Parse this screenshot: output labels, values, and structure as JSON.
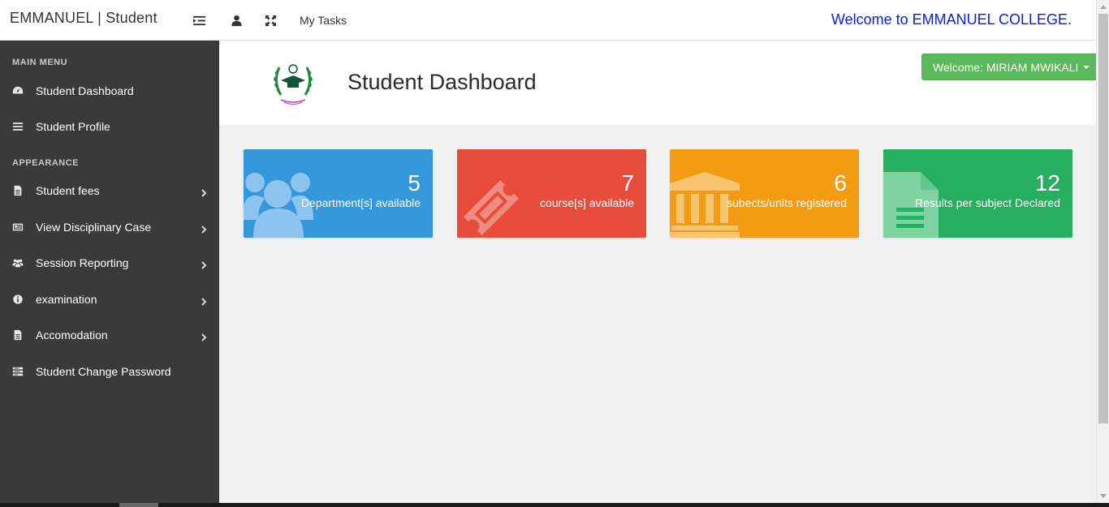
{
  "topbar": {
    "brand": "EMMANUEL | Student",
    "icons": [
      "list-indent-icon",
      "user-icon",
      "fullscreen-icon"
    ],
    "my_tasks": "My Tasks",
    "welcome_college": "Welcome to EMMANUEL COLLEGE."
  },
  "sidebar": {
    "main_menu_label": "MAIN MENU",
    "appearance_label": "APPEARANCE",
    "items": [
      {
        "label": "Student Dashboard",
        "icon": "dashboard-icon",
        "submenu": false
      },
      {
        "label": "Student Profile",
        "icon": "bars-icon",
        "submenu": false
      },
      {
        "label": "Student fees",
        "icon": "file-icon",
        "submenu": true
      },
      {
        "label": "View Disciplinary Case",
        "icon": "newspaper-icon",
        "submenu": true
      },
      {
        "label": "Session Reporting",
        "icon": "users-icon",
        "submenu": true
      },
      {
        "label": "examination",
        "icon": "info-icon",
        "submenu": true
      },
      {
        "label": "Accomodation",
        "icon": "file-icon",
        "submenu": true
      },
      {
        "label": "Student Change Password",
        "icon": "tasks-icon",
        "submenu": false
      }
    ]
  },
  "header": {
    "title": "Student Dashboard",
    "welcome_button": "Welcome: MIRIAM MWIKALI",
    "logo_icon": "emmanuel-college-logo"
  },
  "cards": [
    {
      "count": "5",
      "label": "Department[s] available",
      "color": "#3498db",
      "icon": "users-icon"
    },
    {
      "count": "7",
      "label": "course[s] available",
      "color": "#e74c3c",
      "icon": "ticket-icon"
    },
    {
      "count": "6",
      "label": "subects/units registered",
      "color": "#f39c12",
      "icon": "institution-icon"
    },
    {
      "count": "12",
      "label": "Results per subject Declared",
      "color": "#27ae60",
      "icon": "file-text-icon"
    }
  ]
}
